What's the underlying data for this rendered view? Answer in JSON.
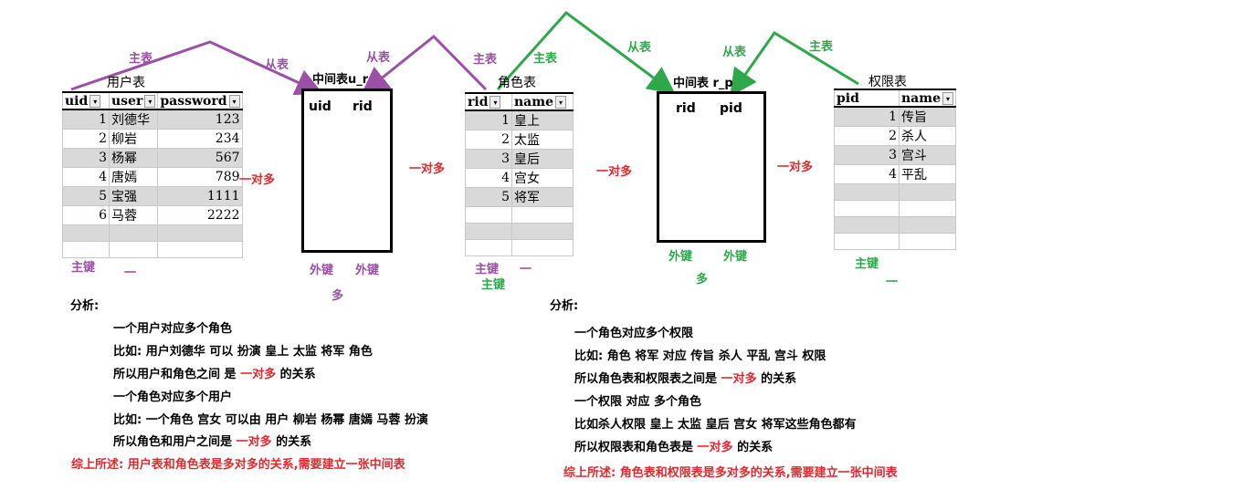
{
  "labels": {
    "zhubiao": "主表",
    "congbiao": "从表",
    "one_to_many": "一对多",
    "zhujian": "主键",
    "waijian": "外键",
    "duo": "多",
    "yi": "一"
  },
  "user_table": {
    "title": "用户表",
    "headers": [
      "uid",
      "user",
      "password"
    ],
    "rows": [
      [
        "1",
        "刘德华",
        "123"
      ],
      [
        "2",
        "柳岩",
        "234"
      ],
      [
        "3",
        "杨幂",
        "567"
      ],
      [
        "4",
        "唐嫣",
        "789"
      ],
      [
        "5",
        "宝强",
        "1111"
      ],
      [
        "6",
        "马蓉",
        "2222"
      ],
      [
        "",
        "",
        ""
      ],
      [
        "",
        "",
        ""
      ]
    ]
  },
  "ur_table": {
    "title": "中间表u_r",
    "cols": [
      "uid",
      "rid"
    ]
  },
  "role_table": {
    "title": "角色表",
    "headers": [
      "rid",
      "name"
    ],
    "rows": [
      [
        "1",
        "皇上"
      ],
      [
        "2",
        "太监"
      ],
      [
        "3",
        "皇后"
      ],
      [
        "4",
        "宫女"
      ],
      [
        "5",
        "将军"
      ],
      [
        "",
        ""
      ],
      [
        "",
        ""
      ],
      [
        "",
        ""
      ]
    ]
  },
  "rp_table": {
    "title": "中间表 r_p",
    "cols": [
      "rid",
      "pid"
    ]
  },
  "perm_table": {
    "title": "权限表",
    "headers": [
      "pid",
      "name"
    ],
    "rows": [
      [
        "1",
        "传旨"
      ],
      [
        "2",
        "杀人"
      ],
      [
        "3",
        "宫斗"
      ],
      [
        "4",
        "平乱"
      ],
      [
        "",
        ""
      ],
      [
        "",
        ""
      ],
      [
        "",
        ""
      ],
      [
        "",
        ""
      ]
    ]
  },
  "analysis_left": {
    "title": "分析:",
    "lines": [
      {
        "pre": "一个用户对应多个角色",
        "red": "",
        "post": ""
      },
      {
        "pre": "比如: 用户刘德华 可以 扮演 皇上 太监 将军 角色",
        "red": "",
        "post": ""
      },
      {
        "pre": "所以用户和角色之间 是 ",
        "red": "一对多",
        "post": " 的关系"
      },
      {
        "pre": "一个角色对应多个用户",
        "red": "",
        "post": ""
      },
      {
        "pre": "比如: 一个角色 宫女 可以由 用户 柳岩 杨幂 唐嫣 马蓉 扮演",
        "red": "",
        "post": ""
      },
      {
        "pre": "所以角色和用户之间是 ",
        "red": "一对多",
        "post": " 的关系"
      }
    ],
    "summary": "综上所述: 用户表和角色表是多对多的关系,需要建立一张中间表"
  },
  "analysis_right": {
    "title": "分析:",
    "lines": [
      {
        "pre": "一个角色对应多个权限",
        "red": "",
        "post": ""
      },
      {
        "pre": "比如: 角色 将军 对应 传旨 杀人 平乱 宫斗 权限",
        "red": "",
        "post": ""
      },
      {
        "pre": "所以角色表和权限表之间是 ",
        "red": "一对多",
        "post": " 的关系"
      },
      {
        "pre": "一个权限 对应 多个角色",
        "red": "",
        "post": ""
      },
      {
        "pre": "比如杀人权限 皇上 太监 皇后 宫女 将军这些角色都有",
        "red": "",
        "post": ""
      },
      {
        "pre": "所以权限表和角色表是 ",
        "red": "一对多",
        "post": " 的关系"
      }
    ],
    "summary": "综上所述: 角色表和权限表是多对多的关系,需要建立一张中间表"
  },
  "colors": {
    "purple": "#9b4fa6",
    "green": "#2ea84a",
    "red": "#e0282e",
    "row_gray": "#d9d9d9"
  }
}
